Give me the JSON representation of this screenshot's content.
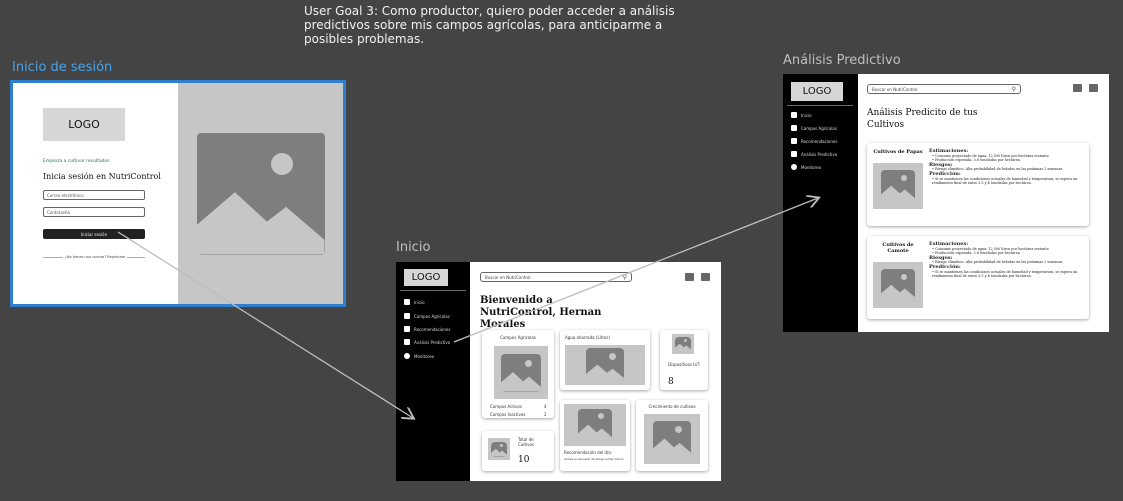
{
  "goal": "User Goal 3: Como productor, quiero poder acceder a análisis predictivos sobre mis campos agrícolas, para anticiparme a posibles problemas.",
  "frames": {
    "login_title": "Inicio de sesión",
    "home_title": "Inicio",
    "predictive_title": "Análisis Predictivo"
  },
  "login": {
    "logo": "LOGO",
    "tagline": "Empieza a cultivar resultados",
    "heading": "Inicia sesión en NutriControl",
    "email_placeholder": "Correo electrónico",
    "password_placeholder": "Contraseña",
    "submit": "Iniciar sesión",
    "register": "¿No tienes una cuenta? Regístrate"
  },
  "sidebar": {
    "logo": "LOGO",
    "items": [
      {
        "label": "Inicio",
        "icon": "home-icon"
      },
      {
        "label": "Campos Agrícolas",
        "icon": "farmer-icon"
      },
      {
        "label": "Recomendaciones",
        "icon": "bulb-icon"
      },
      {
        "label": "Análisis Predictivo",
        "icon": "analytics-icon"
      },
      {
        "label": "Monitoreo",
        "icon": "monitor-icon"
      }
    ]
  },
  "search_placeholder": "Buscar en NutriControl",
  "home": {
    "greeting": "Bienvenido a NutriControl, Hernan Morales",
    "cards": {
      "campos_title": "Campos Agrícolas",
      "campos_activos_label": "Campos Activos",
      "campos_activos_value": "4",
      "campos_inactivos_label": "Campos Inactivos",
      "campos_inactivos_value": "2",
      "agua_title": "Agua ahorrada (Litros)",
      "dispositivos_label": "Dispositivos IoT:",
      "dispositivos_value": "8",
      "total_label": "Total de Cultivos",
      "total_value": "10",
      "recomendacion_title": "Recomendación del día:",
      "recomendacion_text": "Activa el sensado de Riego antes futuro",
      "crecimiento_title": "Crecimiento de cultivos"
    }
  },
  "predictive": {
    "heading": "Análisis Predicito de tus Cultivos",
    "crops": [
      {
        "name": "Cultivos de Papas",
        "estimaciones_label": "Estimaciones:",
        "estimaciones": [
          "Consumo proyectado de agua: 12,500 litros por hectárea restante",
          "Producción esperada: 3.8 toneladas por hectárea"
        ],
        "riesgos_label": "Riesgos:",
        "riesgos": [
          "Riesgo climático: Alta probabilidad de heladas en las próximas 2 semanas"
        ],
        "prediccion_label": "Predicción:",
        "prediccion": [
          "Si se mantienen las condiciones actuales de humedad y temperatura, se espera un rendimiento final de entre 3.5 y 4 toneladas por hectárea."
        ]
      },
      {
        "name": "Cultivos de Camote",
        "estimaciones_label": "Estimaciones:",
        "estimaciones": [
          "Consumo proyectado de agua: 12,500 litros por hectárea restante",
          "Producción esperada: 3.8 toneladas por hectárea"
        ],
        "riesgos_label": "Riesgos:",
        "riesgos": [
          "Riesgo climático: Alta probabilidad de heladas en las próximas 2 semanas"
        ],
        "prediccion_label": "Predicción:",
        "prediccion": [
          "Si se mantienen las condiciones actuales de humedad y temperatura, se espera un rendimiento final de entre 3.5 y 4 toneladas por hectárea."
        ]
      }
    ]
  },
  "colors": {
    "background": "#444444",
    "highlight": "#2f7fd1",
    "sidebar": "#000000"
  }
}
